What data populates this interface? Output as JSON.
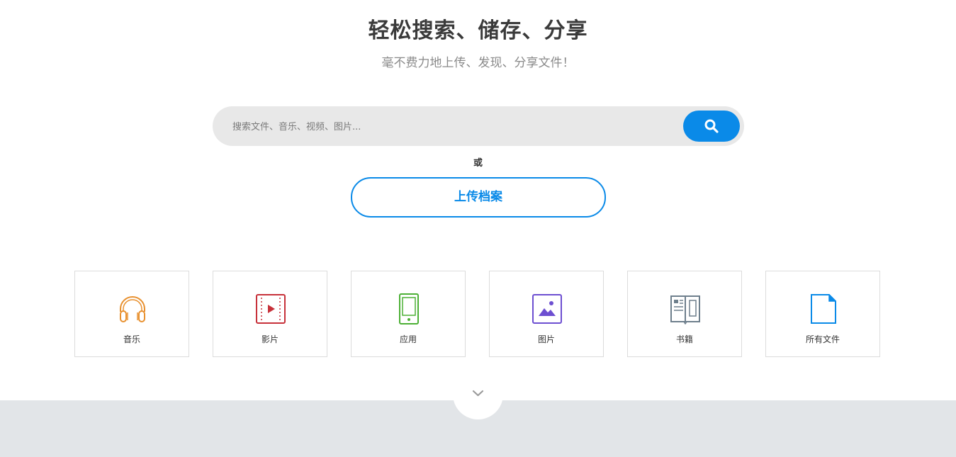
{
  "hero": {
    "title": "轻松搜索、储存、分享",
    "subtitle": "毫不费力地上传、发现、分享文件！"
  },
  "search": {
    "placeholder": "搜索文件、音乐、视频、图片...",
    "button_icon": "search-icon"
  },
  "divider_text": "或",
  "upload": {
    "label": "上传档案"
  },
  "categories": [
    {
      "label": "音乐",
      "icon": "headphones-icon",
      "color": "#e8902e"
    },
    {
      "label": "影片",
      "icon": "film-icon",
      "color": "#c7313a"
    },
    {
      "label": "应用",
      "icon": "mobile-icon",
      "color": "#4cb035"
    },
    {
      "label": "图片",
      "icon": "image-icon",
      "color": "#6d4fd1"
    },
    {
      "label": "书籍",
      "icon": "book-icon",
      "color": "#6e7f8c"
    },
    {
      "label": "所有文件",
      "icon": "file-icon",
      "color": "#0a8ae8"
    }
  ],
  "colors": {
    "accent": "#0a8ae8",
    "search_bg": "#e8e8e8",
    "band_bg": "#e2e5e8"
  },
  "scroll_icon": "chevron-down-icon"
}
